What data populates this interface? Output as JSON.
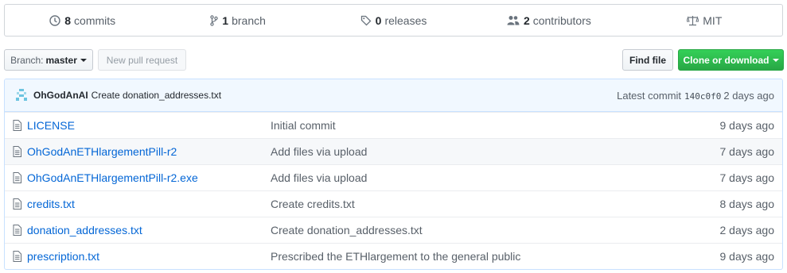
{
  "summary": {
    "commits": {
      "count": "8",
      "label": "commits"
    },
    "branches": {
      "count": "1",
      "label": "branch"
    },
    "releases": {
      "count": "0",
      "label": "releases"
    },
    "contributors": {
      "count": "2",
      "label": "contributors"
    },
    "license": {
      "label": "MIT"
    }
  },
  "toolbar": {
    "branch_key": "Branch:",
    "branch_value": "master",
    "new_pr_label": "New pull request",
    "find_file_label": "Find file",
    "clone_label": "Clone or download"
  },
  "latest_commit": {
    "author": "OhGodAnAI",
    "message": "Create donation_addresses.txt",
    "prefix": "Latest commit",
    "sha": "140c0f0",
    "age": "2 days ago"
  },
  "files": [
    {
      "name": "LICENSE",
      "message": "Initial commit",
      "age": "9 days ago"
    },
    {
      "name": "OhGodAnETHlargementPill-r2",
      "message": "Add files via upload",
      "age": "7 days ago"
    },
    {
      "name": "OhGodAnETHlargementPill-r2.exe",
      "message": "Add files via upload",
      "age": "7 days ago"
    },
    {
      "name": "credits.txt",
      "message": "Create credits.txt",
      "age": "8 days ago"
    },
    {
      "name": "donation_addresses.txt",
      "message": "Create donation_addresses.txt",
      "age": "2 days ago"
    },
    {
      "name": "prescription.txt",
      "message": "Prescribed the ETHlargement to the general public",
      "age": "9 days ago"
    }
  ],
  "colors": {
    "link": "#0366d6",
    "accent_green": "#28a745",
    "commit_bg": "#f1f8ff"
  },
  "icons": {
    "commits": "history-icon",
    "branch": "git-branch-icon",
    "releases": "tag-icon",
    "contributors": "people-icon",
    "license": "law-icon",
    "file": "file-text-icon"
  }
}
